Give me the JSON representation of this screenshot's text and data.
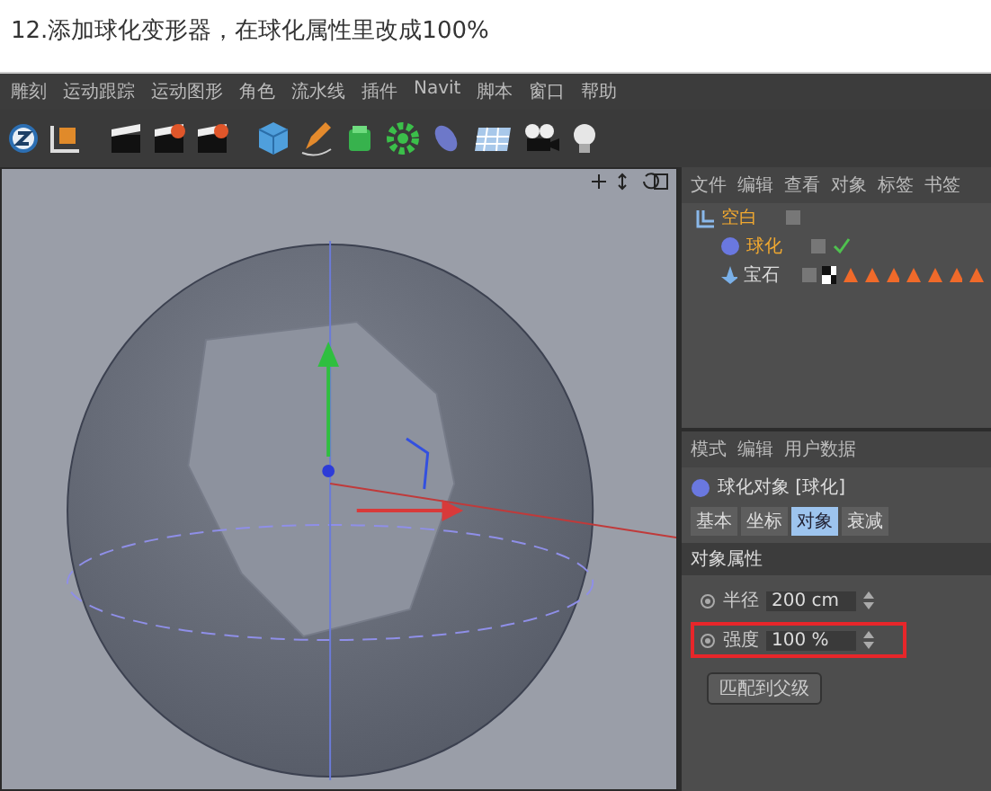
{
  "heading": "12.添加球化变形器，在球化属性里改成100%",
  "app": {
    "menu": [
      "雕刻",
      "运动跟踪",
      "运动图形",
      "角色",
      "流水线",
      "插件",
      "Navit",
      "脚本",
      "窗口",
      "帮助"
    ],
    "object_manager": {
      "menu": [
        "文件",
        "编辑",
        "查看",
        "对象",
        "标签",
        "书签"
      ],
      "objects": [
        {
          "name": "空白",
          "selected": true,
          "children": [
            {
              "name": "球化",
              "selected": true,
              "enabled": true
            },
            {
              "name": "宝石",
              "selected": false
            }
          ]
        }
      ]
    },
    "attributes": {
      "menu": [
        "模式",
        "编辑",
        "用户数据"
      ],
      "title": "球化对象 [球化]",
      "tabs": [
        {
          "label": "基本",
          "selected": false
        },
        {
          "label": "坐标",
          "selected": false
        },
        {
          "label": "对象",
          "selected": true
        },
        {
          "label": "衰减",
          "selected": false
        }
      ],
      "section": "对象属性",
      "fields": [
        {
          "label": "半径",
          "value": "200 cm",
          "highlighted": false
        },
        {
          "label": "强度",
          "value": "100 %",
          "highlighted": true
        }
      ],
      "button": "匹配到父级"
    }
  }
}
